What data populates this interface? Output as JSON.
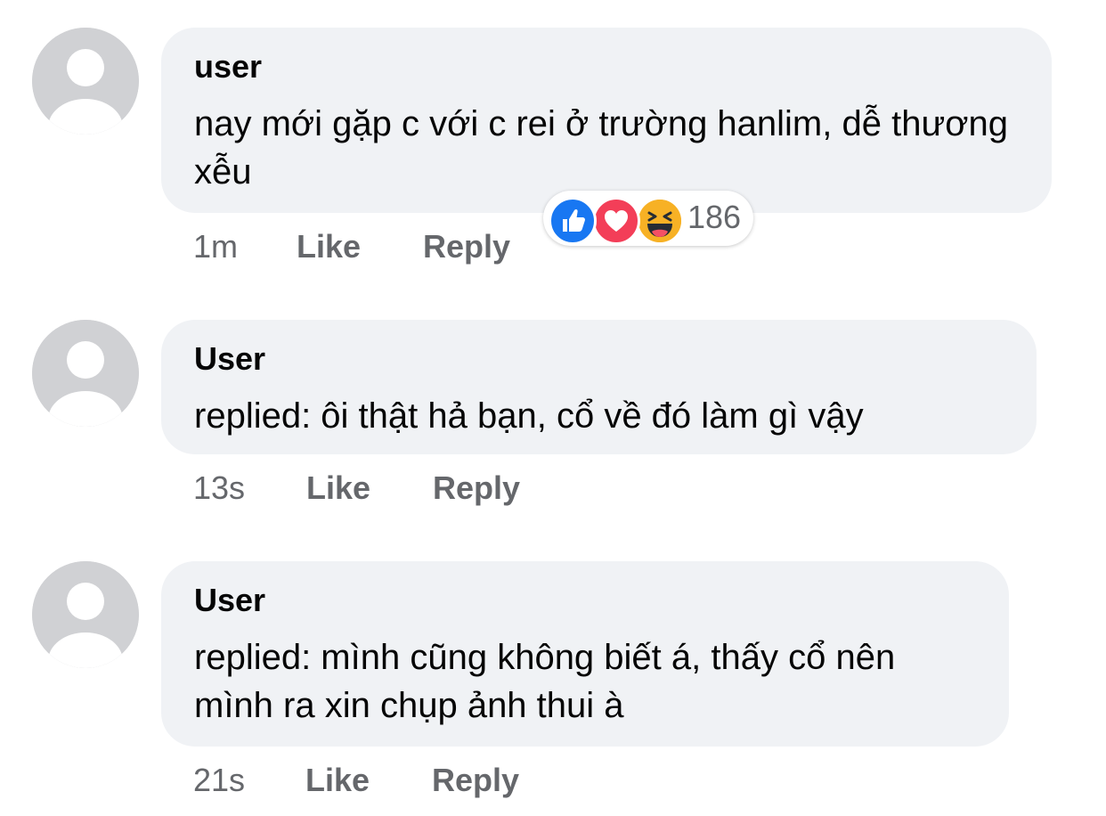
{
  "comments": [
    {
      "author": "user",
      "text": "nay mới gặp c với c rei ở trường hanlim, dễ thương xễu",
      "time": "1m",
      "like_label": "Like",
      "reply_label": "Reply",
      "reactions": {
        "icons": [
          "like-icon",
          "love-icon",
          "haha-icon"
        ],
        "count": "186"
      }
    },
    {
      "author": "User",
      "text": "replied: ôi thật hả bạn, cổ về đó làm gì vậy",
      "time": "13s",
      "like_label": "Like",
      "reply_label": "Reply"
    },
    {
      "author": "User",
      "text": "replied: mình cũng không biết á, thấy cổ nên mình ra xin chụp ảnh thui à",
      "time": "21s",
      "like_label": "Like",
      "reply_label": "Reply"
    }
  ],
  "colors": {
    "bubble": "#f0f2f5",
    "secondary_text": "#65676b",
    "like_blue": "#1877f2",
    "love_red": "#f33e58",
    "haha_yellow": "#f7b125"
  }
}
